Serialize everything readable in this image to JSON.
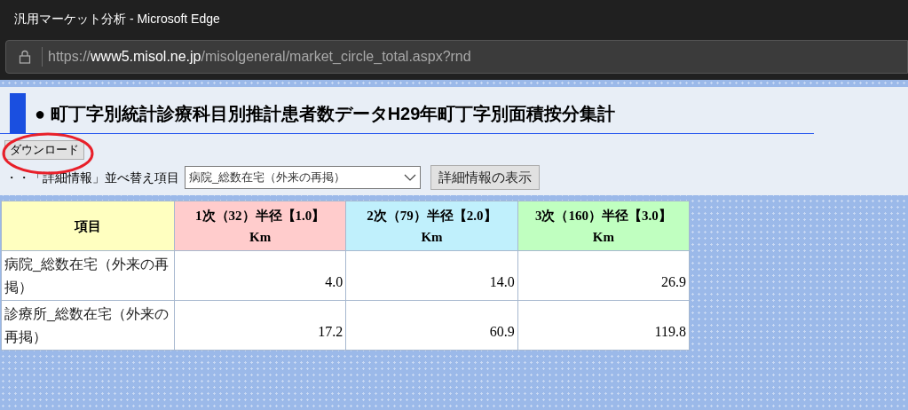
{
  "window": {
    "title": "汎用マーケット分析 - Microsoft Edge"
  },
  "address_bar": {
    "scheme": "https://",
    "host": "www5.misol.ne.jp",
    "path": "/misolgeneral/market_circle_total.aspx?rnd"
  },
  "heading": "● 町丁字別統計診療科目別推計患者数データH29年町丁字別面積按分集計",
  "download_button": {
    "label": "ダウンロード",
    "highlighted": true
  },
  "sort": {
    "label": "・・「詳細情報」並べ替え項目",
    "value": "病院_総数在宅（外来の再掲）",
    "button": "詳細情報の表示"
  },
  "table": {
    "columns": [
      {
        "label": "項目",
        "color": "#ffffc0"
      },
      {
        "label": "1次（32）半径【1.0】Km",
        "color": "#ffcccc"
      },
      {
        "label": "2次（79）半径【2.0】Km",
        "color": "#c0f0fc"
      },
      {
        "label": "3次（160）半径【3.0】Km",
        "color": "#c0ffc0"
      }
    ],
    "rows": [
      {
        "item": "病院_総数在宅（外来の再掲）",
        "values": [
          "4.0",
          "14.0",
          "26.9"
        ]
      },
      {
        "item": "診療所_総数在宅（外来の再掲）",
        "values": [
          "17.2",
          "60.9",
          "119.8"
        ]
      }
    ]
  }
}
